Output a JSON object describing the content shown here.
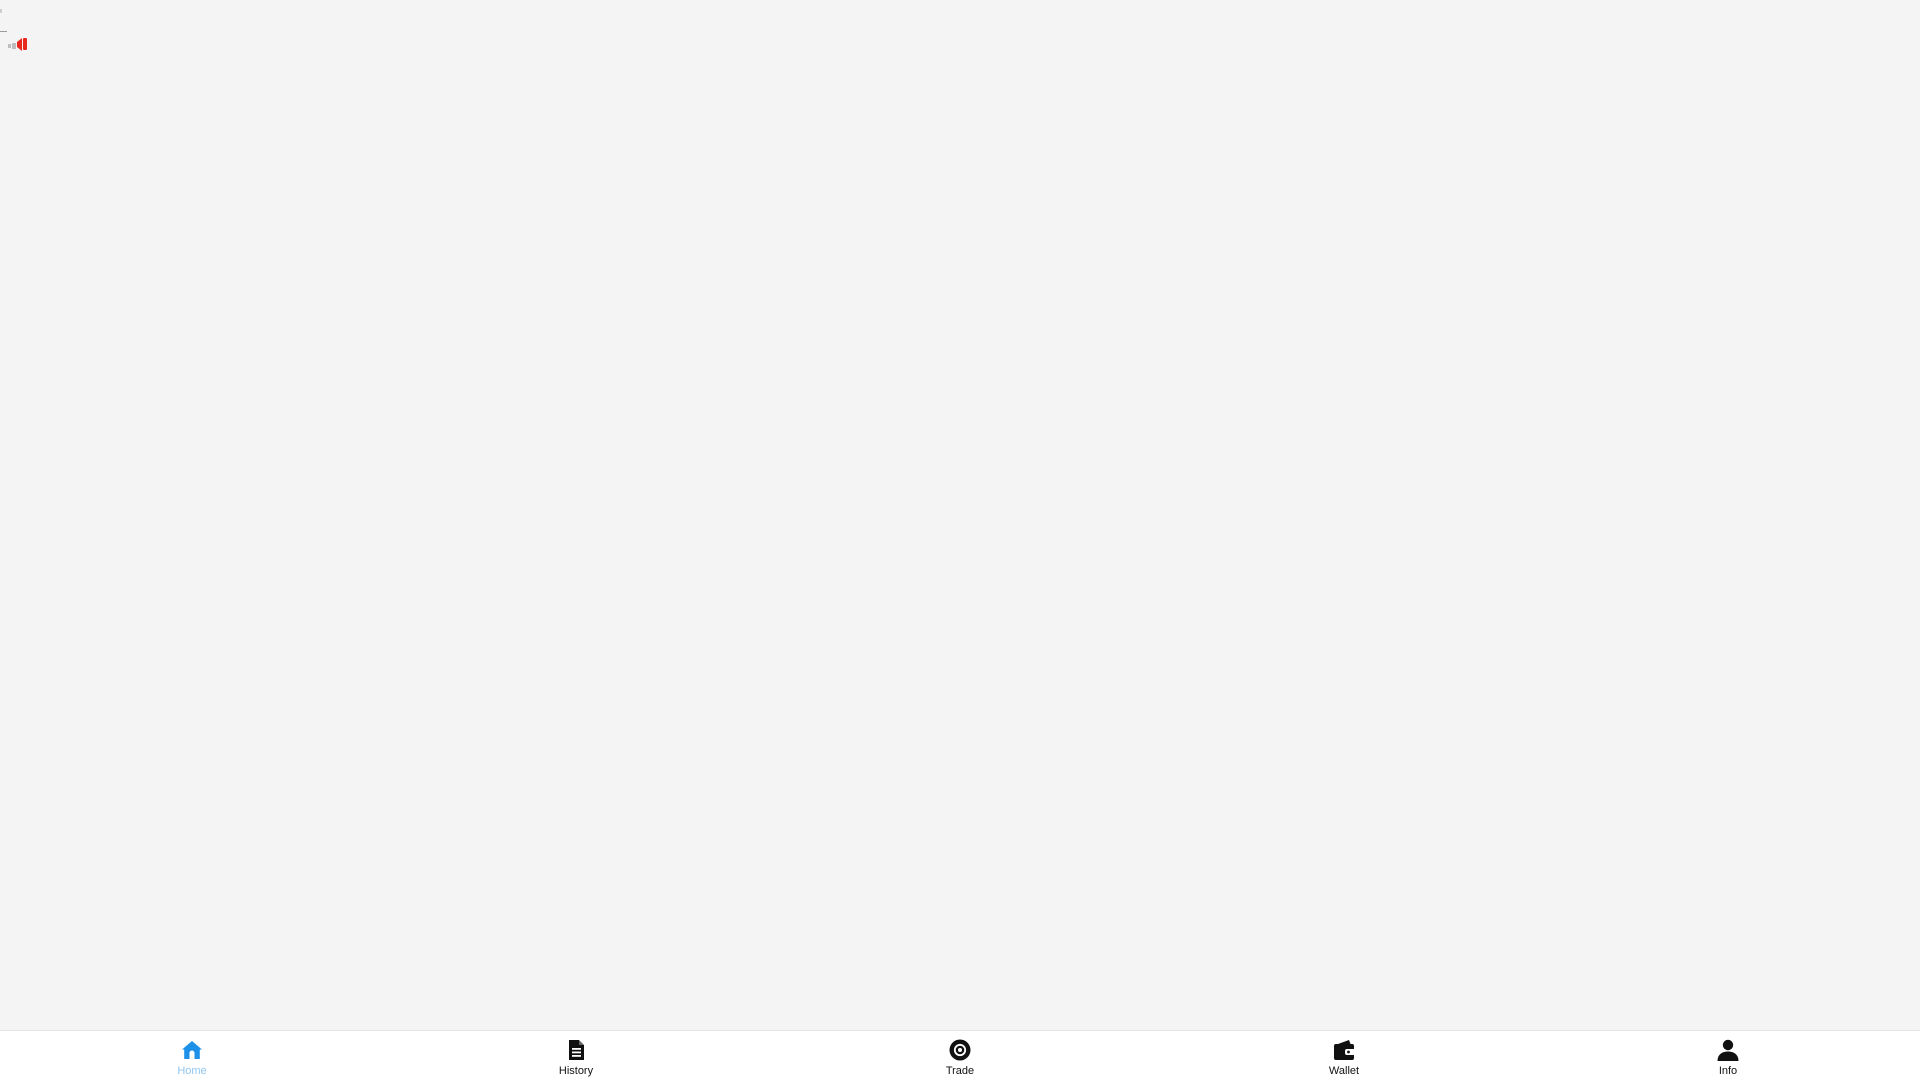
{
  "colors": {
    "background": "#f4f4f4",
    "tabbar_background": "#ffffff",
    "active": "#1e90e8",
    "active_label": "#8ec6f0",
    "inactive": "#111111",
    "sound_icon": "#e8281e"
  },
  "top_left": {
    "icon": "sound-icon"
  },
  "tabbar": {
    "active_index": 0,
    "tabs": [
      {
        "label": "Home",
        "icon": "home-icon"
      },
      {
        "label": "History",
        "icon": "document-icon"
      },
      {
        "label": "Trade",
        "icon": "trade-icon"
      },
      {
        "label": "Wallet",
        "icon": "wallet-icon"
      },
      {
        "label": "Info",
        "icon": "user-icon"
      }
    ]
  }
}
